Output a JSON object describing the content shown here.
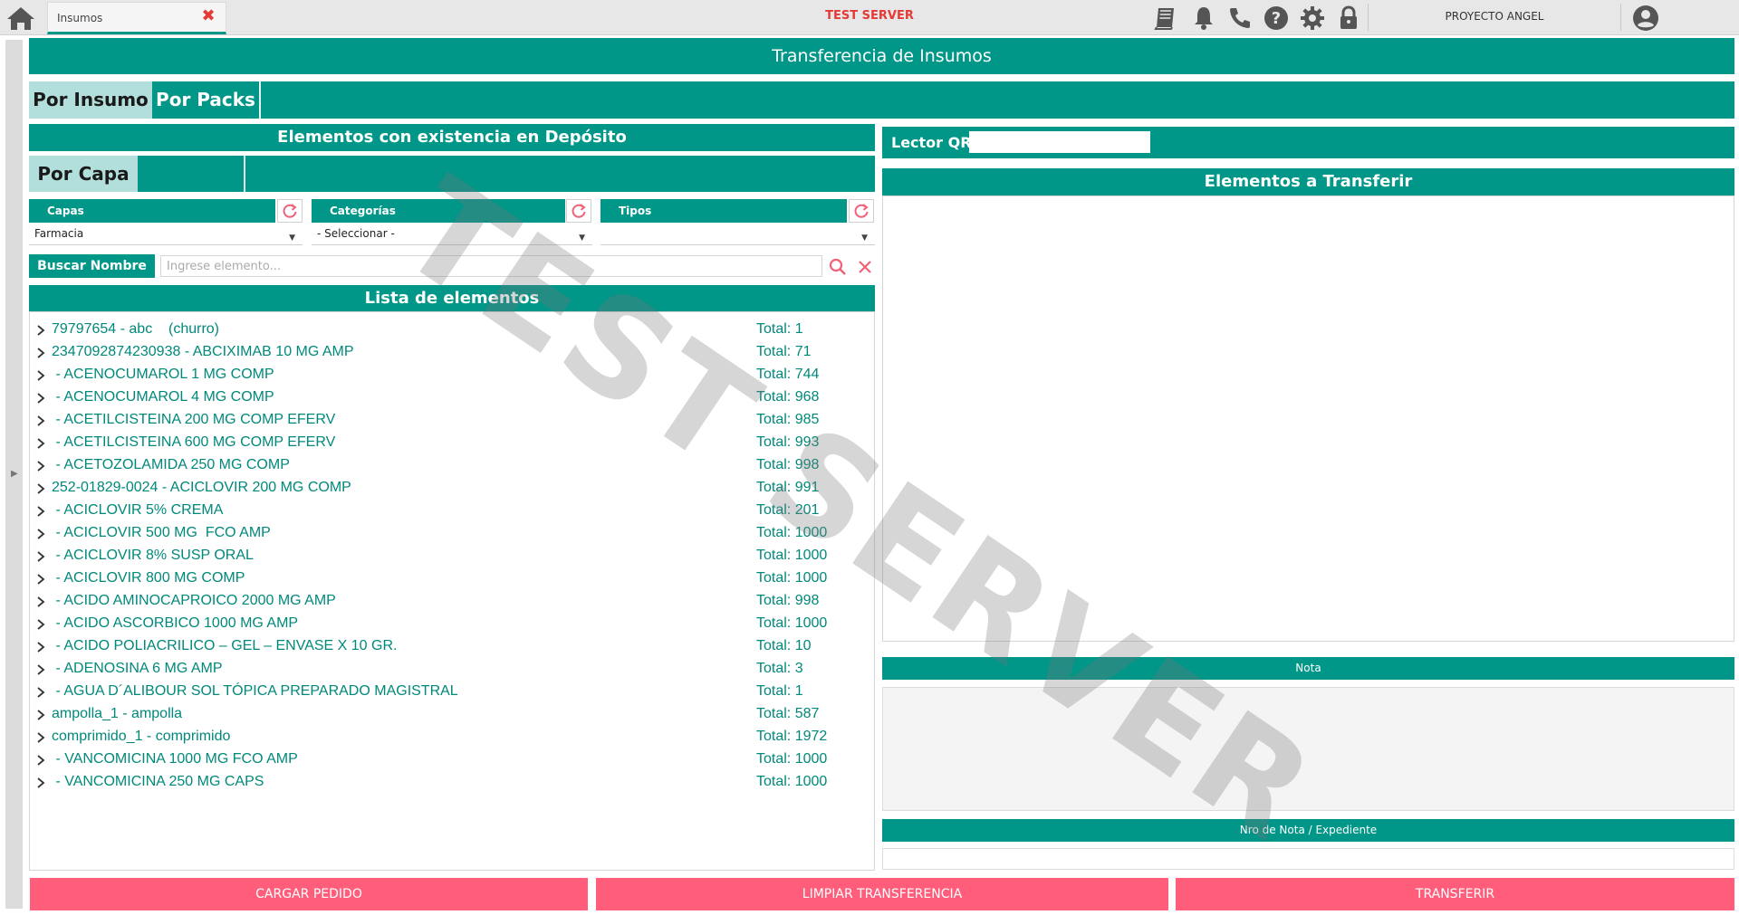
{
  "topbar": {
    "tab_label": "Insumos",
    "tab_close": "✖",
    "server_label": "TEST SERVER",
    "user_label": "PROYECTO ANGEL",
    "icons": [
      "home-icon",
      "book-icon",
      "bell-icon",
      "phone-icon",
      "help-icon",
      "gear-icon",
      "lock-icon",
      "user-icon"
    ]
  },
  "page": {
    "title": "Transferencia de Insumos",
    "mode_tabs": [
      "Por Insumo",
      "Por Packs"
    ],
    "active_mode": "Por Insumo"
  },
  "stock": {
    "header": "Elementos con existencia en Depósito",
    "sub_tab": "Por Capa",
    "filters": {
      "capas": {
        "label": "Capas",
        "value": "Farmacia"
      },
      "categorias": {
        "label": "Categorías",
        "value": "- Seleccionar -"
      },
      "tipos": {
        "label": "Tipos",
        "value": ""
      }
    },
    "search": {
      "label": "Buscar Nombre",
      "placeholder": "Ingrese elemento..."
    },
    "list_header": "Lista de elementos",
    "items": [
      {
        "name": "79797654 - abc    (churro)",
        "total": "Total: 1"
      },
      {
        "name": "2347092874230938 - ABCIXIMAB 10 MG AMP",
        "total": "Total: 71"
      },
      {
        "name": " - ACENOCUMAROL 1 MG COMP",
        "total": "Total: 744"
      },
      {
        "name": " - ACENOCUMAROL 4 MG COMP",
        "total": "Total: 968"
      },
      {
        "name": " - ACETILCISTEINA 200 MG COMP EFERV",
        "total": "Total: 985"
      },
      {
        "name": " - ACETILCISTEINA 600 MG COMP EFERV",
        "total": "Total: 993"
      },
      {
        "name": " - ACETOZOLAMIDA 250 MG COMP",
        "total": "Total: 998"
      },
      {
        "name": "252-01829-0024 - ACICLOVIR 200 MG COMP",
        "total": "Total: 991"
      },
      {
        "name": " - ACICLOVIR 5% CREMA",
        "total": "Total: 201"
      },
      {
        "name": " - ACICLOVIR 500 MG  FCO AMP",
        "total": "Total: 1000"
      },
      {
        "name": " - ACICLOVIR 8% SUSP ORAL",
        "total": "Total: 1000"
      },
      {
        "name": " - ACICLOVIR 800 MG COMP",
        "total": "Total: 1000"
      },
      {
        "name": " - ACIDO AMINOCAPROICO 2000 MG AMP",
        "total": "Total: 998"
      },
      {
        "name": " - ACIDO ASCORBICO 1000 MG AMP",
        "total": "Total: 1000"
      },
      {
        "name": " - ACIDO POLIACRILICO – GEL – ENVASE X 10 GR.",
        "total": "Total: 10"
      },
      {
        "name": " - ADENOSINA 6 MG AMP",
        "total": "Total: 3"
      },
      {
        "name": " - AGUA D´ALIBOUR SOL TÓPICA PREPARADO MAGISTRAL",
        "total": "Total: 1"
      },
      {
        "name": "ampolla_1 - ampolla",
        "total": "Total: 587"
      },
      {
        "name": "comprimido_1 - comprimido",
        "total": "Total: 1972"
      },
      {
        "name": " - VANCOMICINA 1000 MG FCO AMP",
        "total": "Total: 1000"
      },
      {
        "name": " - VANCOMICINA 250 MG CAPS",
        "total": "Total: 1000"
      }
    ]
  },
  "transfer": {
    "qr_label": "Lector QR",
    "qr_value": "",
    "header": "Elementos a Transferir",
    "nota_label": "Nota",
    "expediente_label": "Nro de Nota / Expediente"
  },
  "actions": {
    "cargar": "CARGAR PEDIDO",
    "limpiar": "LIMPIAR TRANSFERENCIA",
    "transferir": "TRANSFERIR"
  },
  "watermark": "TEST SERVER",
  "colors": {
    "teal": "#009688",
    "teal_light": "#b2dfdb",
    "item_text": "#00897b",
    "action": "#ff5d7a",
    "server_label": "#e53935"
  }
}
